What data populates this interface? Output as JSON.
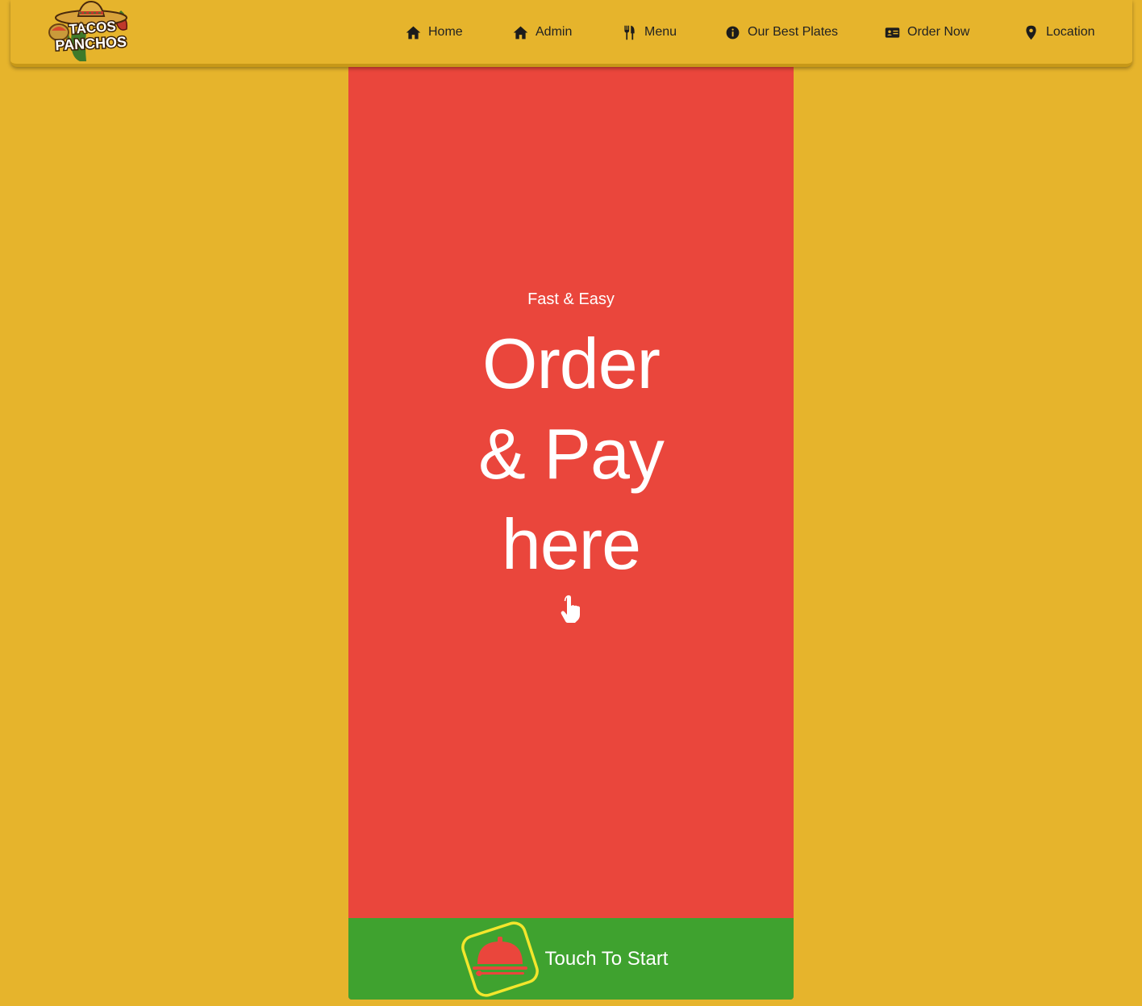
{
  "brand": {
    "logo_line1": "TACOS",
    "logo_line2": "PANCHOS"
  },
  "nav": {
    "items": [
      {
        "label": "Home",
        "icon": "home-icon"
      },
      {
        "label": "Admin",
        "icon": "home-icon"
      },
      {
        "label": "Menu",
        "icon": "utensils-icon"
      },
      {
        "label": "Our Best Plates",
        "icon": "info-icon"
      },
      {
        "label": "Order Now",
        "icon": "id-card-icon"
      },
      {
        "label": "Location",
        "icon": "map-pin-icon"
      }
    ]
  },
  "hero": {
    "subtitle": "Fast & Easy",
    "line1": "Order",
    "line2": "& Pay",
    "line3": "here",
    "icon": "hand-pointer-icon"
  },
  "start": {
    "label": "Touch To Start",
    "icon": "serving-cloche-icon"
  },
  "colors": {
    "background": "#E6B42C",
    "panel": "#EA463C",
    "start_bar": "#3FA22F",
    "icon_outline": "#F3E62C"
  }
}
